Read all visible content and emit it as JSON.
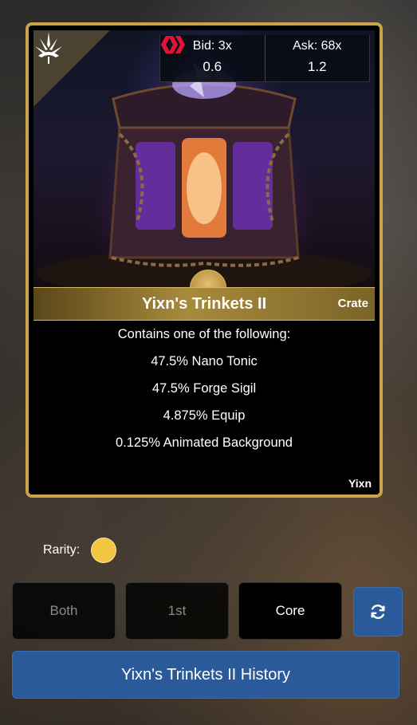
{
  "card": {
    "title": "Yixn's Trinkets II",
    "type": "Crate",
    "creator": "Yixn",
    "description_header": "Contains one of the following:",
    "contents": [
      "47.5% Nano Tonic",
      "47.5% Forge Sigil",
      "4.875% Equip",
      "0.125% Animated Background"
    ],
    "bid": {
      "label": "Bid: 3x",
      "price": "0.6",
      "icon": "hive-icon"
    },
    "ask": {
      "label": "Ask: 68x",
      "price": "1.2",
      "icon": "hive-icon"
    },
    "corner_icon": "crown-emblem-icon"
  },
  "rarity": {
    "label": "Rarity:",
    "color": "#f4c542"
  },
  "segments": [
    {
      "label": "Both",
      "active": false
    },
    {
      "label": "1st",
      "active": false
    },
    {
      "label": "Core",
      "active": true
    }
  ],
  "refresh_icon": "refresh-icon",
  "history_button": "Yixn's Trinkets II History",
  "colors": {
    "card_border": "#c9a24a",
    "button_blue": "#2a5a9a",
    "hive_red": "#e31337"
  }
}
